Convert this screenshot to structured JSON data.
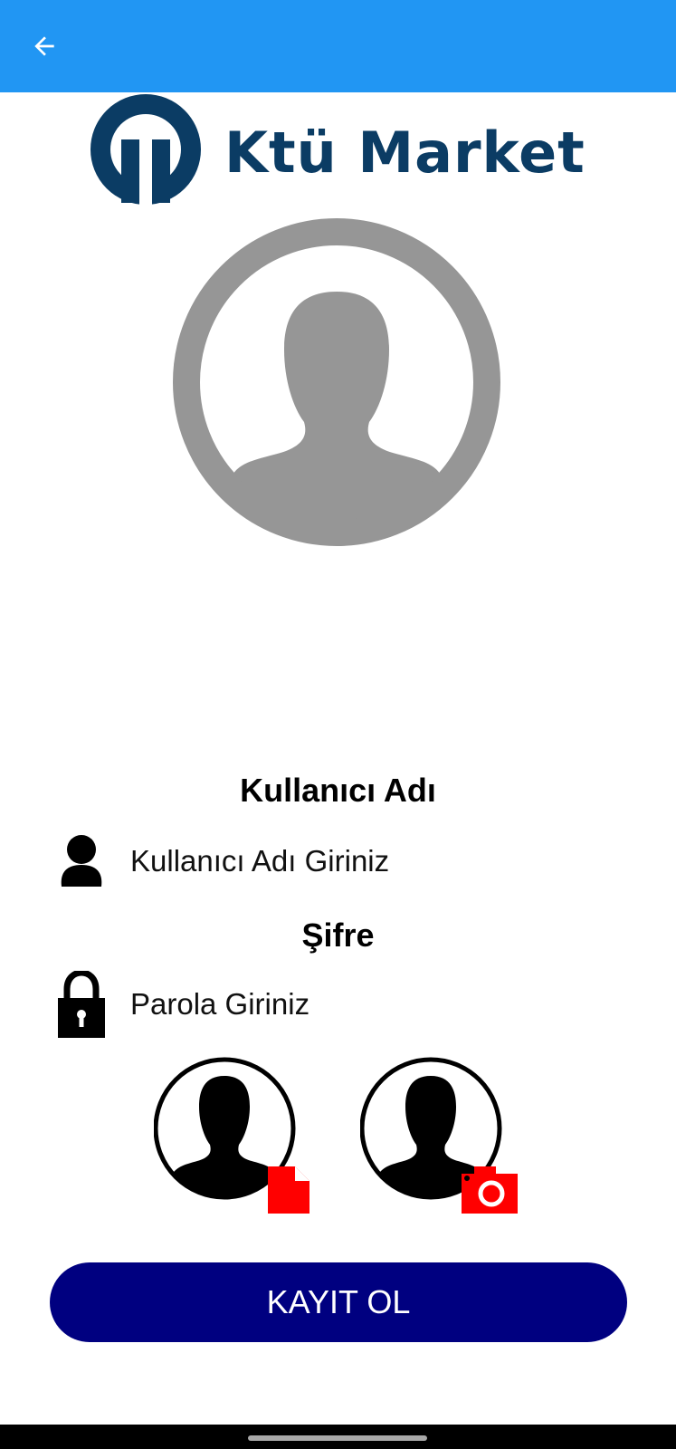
{
  "app_bar": {
    "back_icon": "arrow-back-icon",
    "color": "#2196F3"
  },
  "logo": {
    "text": "Ktü Market",
    "color": "#0b3c64"
  },
  "profile_photo": {
    "icon": "person-silhouette-icon",
    "color": "#969696"
  },
  "username": {
    "label": "Kullanıcı Adı",
    "icon": "person-icon",
    "placeholder": "Kullanıcı Adı Giriniz",
    "value": ""
  },
  "password": {
    "label": "Şifre",
    "icon": "lock-icon",
    "placeholder": "Parola Giriniz",
    "value": ""
  },
  "photo_pickers": [
    {
      "icon": "person-file-icon",
      "badge": "file-icon",
      "badge_color": "#FF0000"
    },
    {
      "icon": "person-camera-icon",
      "badge": "camera-icon",
      "badge_color": "#FF0000"
    }
  ],
  "register_button": {
    "label": "KAYIT OL",
    "color": "#000080"
  }
}
